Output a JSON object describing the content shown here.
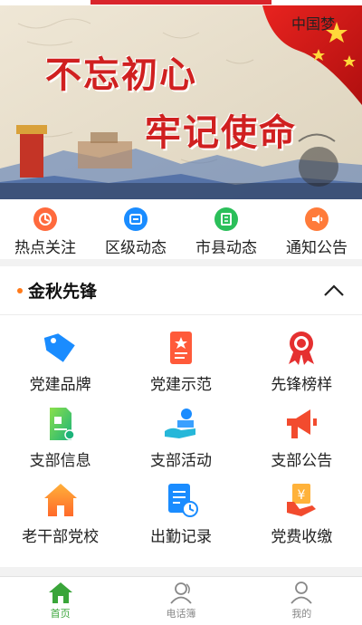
{
  "banner": {
    "line1": "不忘初心",
    "line2": "牢记使命"
  },
  "quick_nav": [
    {
      "label": "热点关注",
      "icon": "hot-topic-icon",
      "color": "#ff6a3d"
    },
    {
      "label": "区级动态",
      "icon": "district-news-icon",
      "color": "#1a8cff"
    },
    {
      "label": "市县动态",
      "icon": "city-news-icon",
      "color": "#2bbf5a"
    },
    {
      "label": "通知公告",
      "icon": "notice-icon",
      "color": "#ff7b3a"
    }
  ],
  "section": {
    "title": "金秋先锋",
    "accent": "#ff7a1a"
  },
  "grid": [
    {
      "label": "党建品牌",
      "icon": "brand-tag-icon"
    },
    {
      "label": "党建示范",
      "icon": "demo-document-icon"
    },
    {
      "label": "先锋榜样",
      "icon": "award-ribbon-icon"
    },
    {
      "label": "支部信息",
      "icon": "branch-info-icon"
    },
    {
      "label": "支部活动",
      "icon": "branch-activity-icon"
    },
    {
      "label": "支部公告",
      "icon": "megaphone-icon"
    },
    {
      "label": "老干部党校",
      "icon": "school-house-icon"
    },
    {
      "label": "出勤记录",
      "icon": "attendance-icon"
    },
    {
      "label": "党费收缴",
      "icon": "fee-payment-icon"
    }
  ],
  "tabs": [
    {
      "label": "首页",
      "icon": "home-icon",
      "active": true
    },
    {
      "label": "电话簿",
      "icon": "contacts-icon",
      "active": false
    },
    {
      "label": "我的",
      "icon": "profile-icon",
      "active": false
    }
  ],
  "colors": {
    "brand_red": "#d02020",
    "active_tab": "#3aa53a"
  }
}
